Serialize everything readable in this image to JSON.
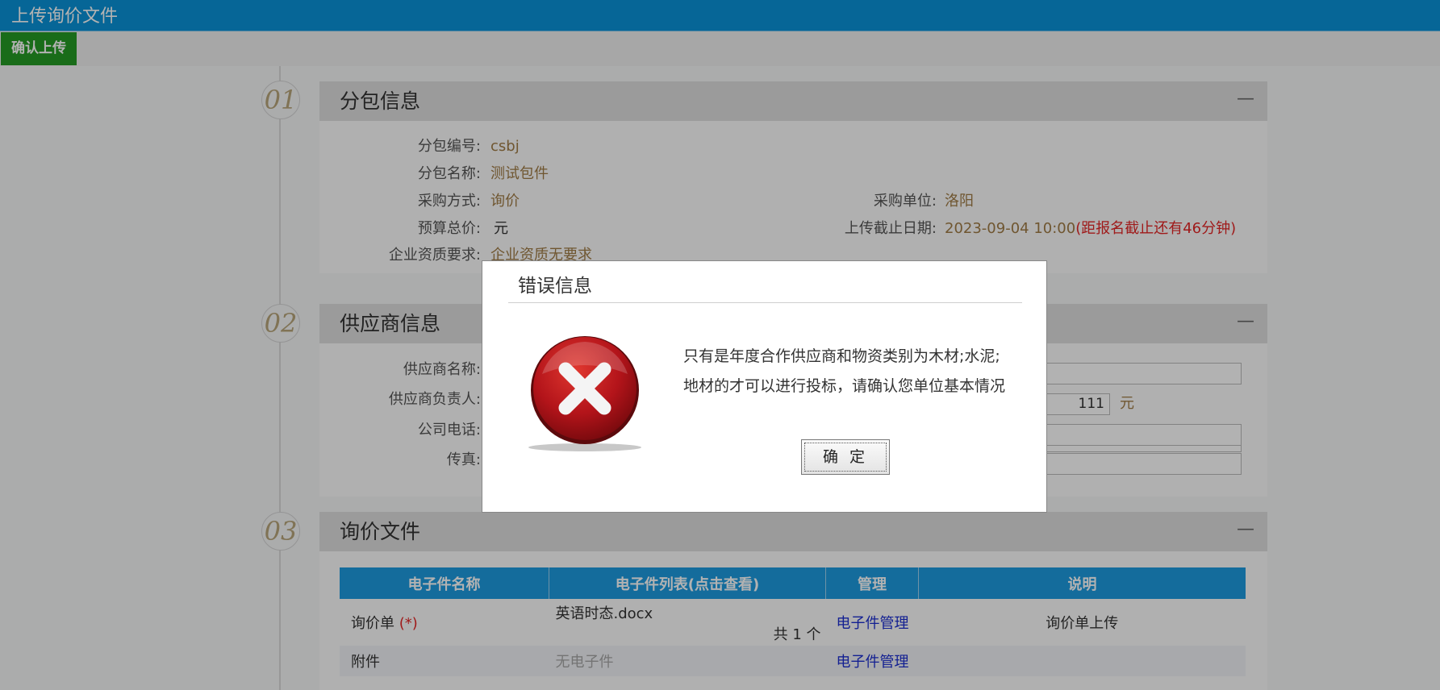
{
  "title": "上传询价文件",
  "toolbar": {
    "confirm_upload": "确认上传"
  },
  "sections": [
    {
      "number": "01",
      "title": "分包信息",
      "collapse": "—"
    },
    {
      "number": "02",
      "title": "供应商信息",
      "collapse": "—"
    },
    {
      "number": "03",
      "title": "询价文件",
      "collapse": "—"
    }
  ],
  "package": {
    "code_label": "分包编号:",
    "code": "csbj",
    "name_label": "分包名称:",
    "name": "测试包件",
    "method_label": "采购方式:",
    "method": "询价",
    "unit_label": "采购单位:",
    "unit": "洛阳",
    "budget_label": "预算总价:",
    "budget_unit": "元",
    "deadline_label": "上传截止日期:",
    "deadline": "2023-09-04 10:00",
    "deadline_note": "(距报名截止还有46分钟)",
    "qualification_label": "企业资质要求:",
    "qualification": "企业资质无要求"
  },
  "supplier": {
    "name_label": "供应商名称:",
    "contact_label": "供应商负责人:",
    "phone_label": "公司电话:",
    "fax_label": "传真:",
    "amount_value": "111",
    "amount_unit": "元"
  },
  "files": {
    "headers": [
      "电子件名称",
      "电子件列表(点击查看)",
      "管理",
      "说明"
    ],
    "rows": [
      {
        "name": "询价单",
        "required": "(*)",
        "file": "英语时态.docx",
        "count": "共 1 个",
        "manage": "电子件管理",
        "desc": "询价单上传"
      },
      {
        "name": "附件",
        "file": "无电子件",
        "manage": "电子件管理",
        "desc": ""
      }
    ]
  },
  "dialog": {
    "title": "错误信息",
    "message_line1": "只有是年度合作供应商和物资类别为木材;水泥;",
    "message_line2": "地材的才可以进行投标，请确认您单位基本情况",
    "ok": "确 定",
    "icon": "error-x-icon"
  },
  "colors": {
    "titlebar": "#0a93d8",
    "confirm_button": "#249b24",
    "table_header": "#1d9be0",
    "link": "#1c2fd1",
    "warning_text": "#e42626"
  }
}
